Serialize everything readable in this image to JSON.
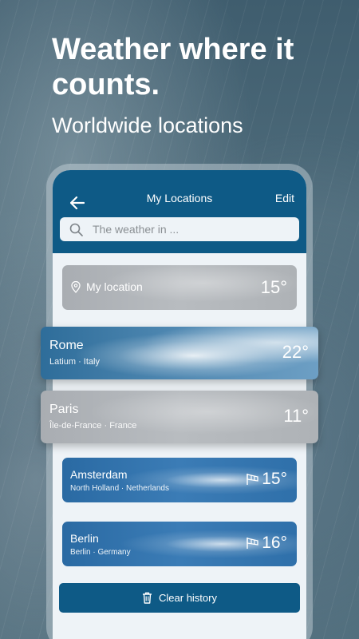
{
  "promo": {
    "headline": "Weather where it counts.",
    "subline": "Worldwide locations"
  },
  "topbar": {
    "title": "My Locations",
    "edit_label": "Edit",
    "back_icon": "arrow-left-icon"
  },
  "search": {
    "placeholder": "The weather in ..."
  },
  "locations": [
    {
      "name": "My location",
      "region": "",
      "temp": "15°",
      "condition": "cloudy"
    },
    {
      "name": "Rome",
      "region": "Latium · Italy",
      "temp": "22°",
      "condition": "partly-cloudy"
    },
    {
      "name": "Paris",
      "region": "Île-de-France · France",
      "temp": "11°",
      "condition": "cloudy"
    },
    {
      "name": "Amsterdam",
      "region": "North Holland · Netherlands",
      "temp": "15°",
      "condition": "sunny-windy"
    },
    {
      "name": "Berlin",
      "region": "Berlin · Germany",
      "temp": "16°",
      "condition": "sunny-windy"
    }
  ],
  "clear_history_label": "Clear history",
  "colors": {
    "header_blue": "#0e5a86",
    "button_blue": "#0e5a86",
    "screen_bg": "#eef3f7"
  }
}
